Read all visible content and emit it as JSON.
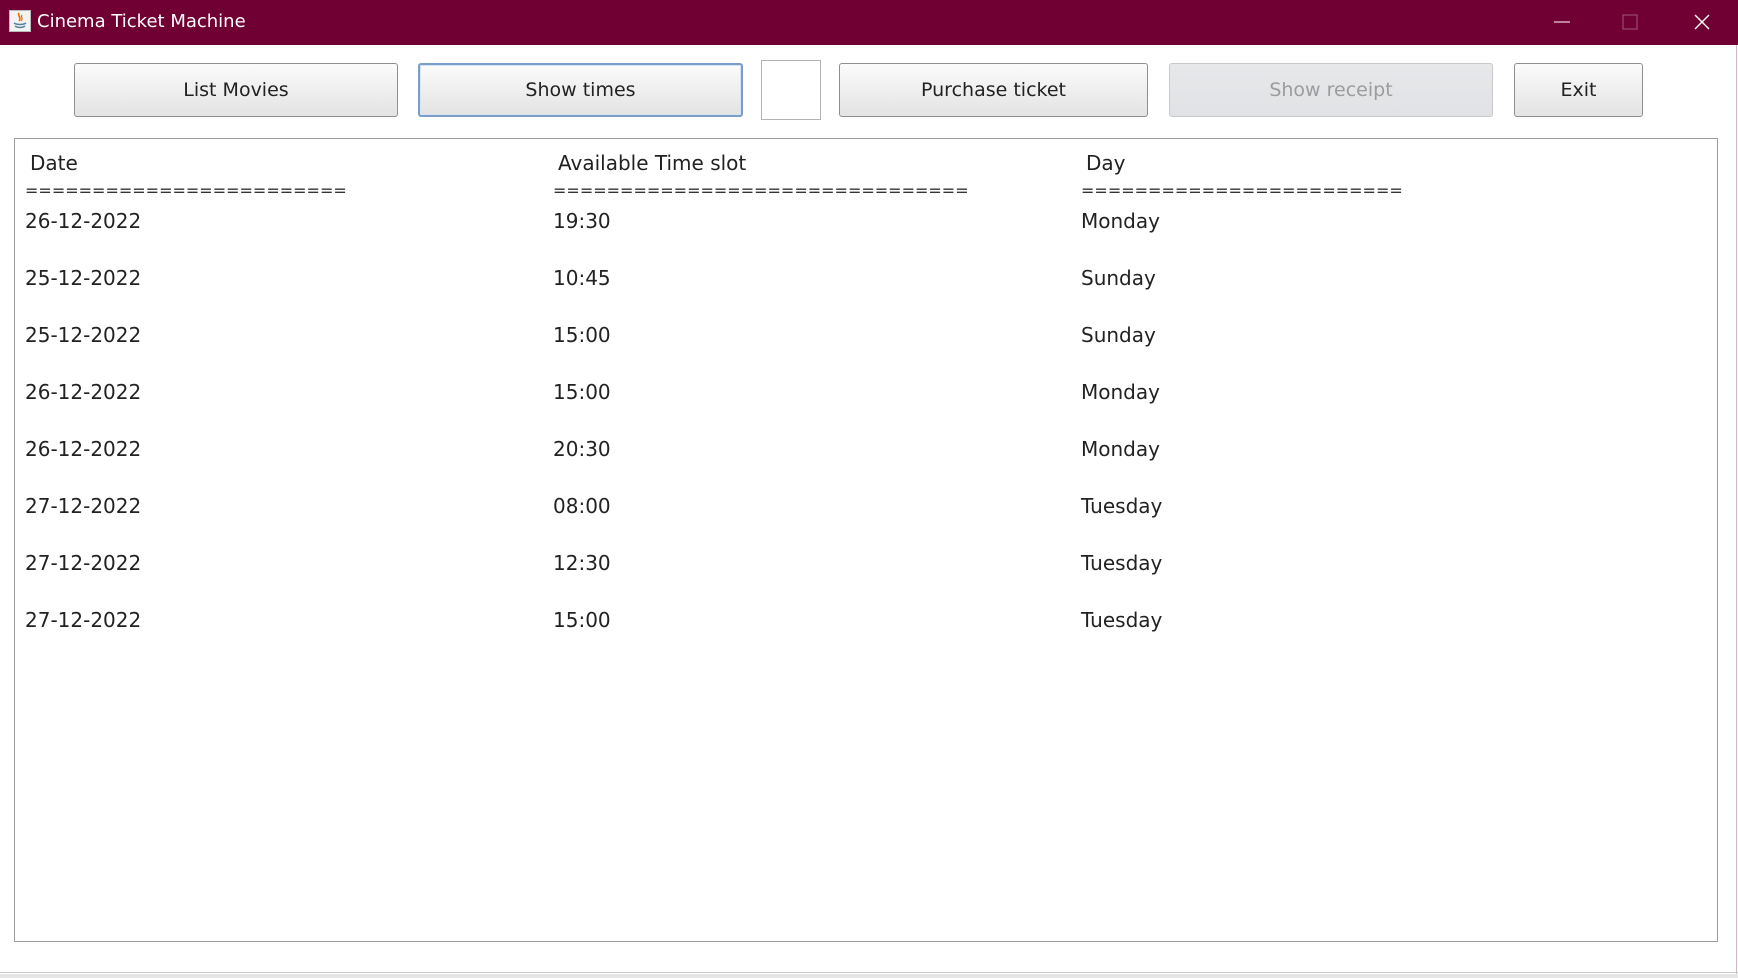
{
  "window": {
    "title": "Cinema Ticket Machine",
    "titlebar_color": "#700034",
    "icons": {
      "app": "java-app-icon",
      "minimize": "minimize-icon",
      "maximize": "maximize-icon",
      "close": "close-icon"
    }
  },
  "toolbar": {
    "list_movies_label": "List Movies",
    "show_times_label": "Show times",
    "purchase_ticket_label": "Purchase ticket",
    "show_receipt_label": "Show receipt",
    "exit_label": "Exit",
    "input_value": ""
  },
  "output": {
    "headers": [
      "Date",
      "Available Time slot",
      "Day"
    ],
    "separators": [
      "========================",
      "===============================",
      "========================"
    ],
    "rows": [
      {
        "date": "26-12-2022",
        "time": "19:30",
        "day": "Monday"
      },
      {
        "date": "25-12-2022",
        "time": "10:45",
        "day": "Sunday"
      },
      {
        "date": "25-12-2022",
        "time": "15:00",
        "day": "Sunday"
      },
      {
        "date": "26-12-2022",
        "time": "15:00",
        "day": "Monday"
      },
      {
        "date": "26-12-2022",
        "time": "20:30",
        "day": "Monday"
      },
      {
        "date": "27-12-2022",
        "time": "08:00",
        "day": "Tuesday"
      },
      {
        "date": "27-12-2022",
        "time": "12:30",
        "day": "Tuesday"
      },
      {
        "date": "27-12-2022",
        "time": "15:00",
        "day": "Tuesday"
      }
    ]
  }
}
